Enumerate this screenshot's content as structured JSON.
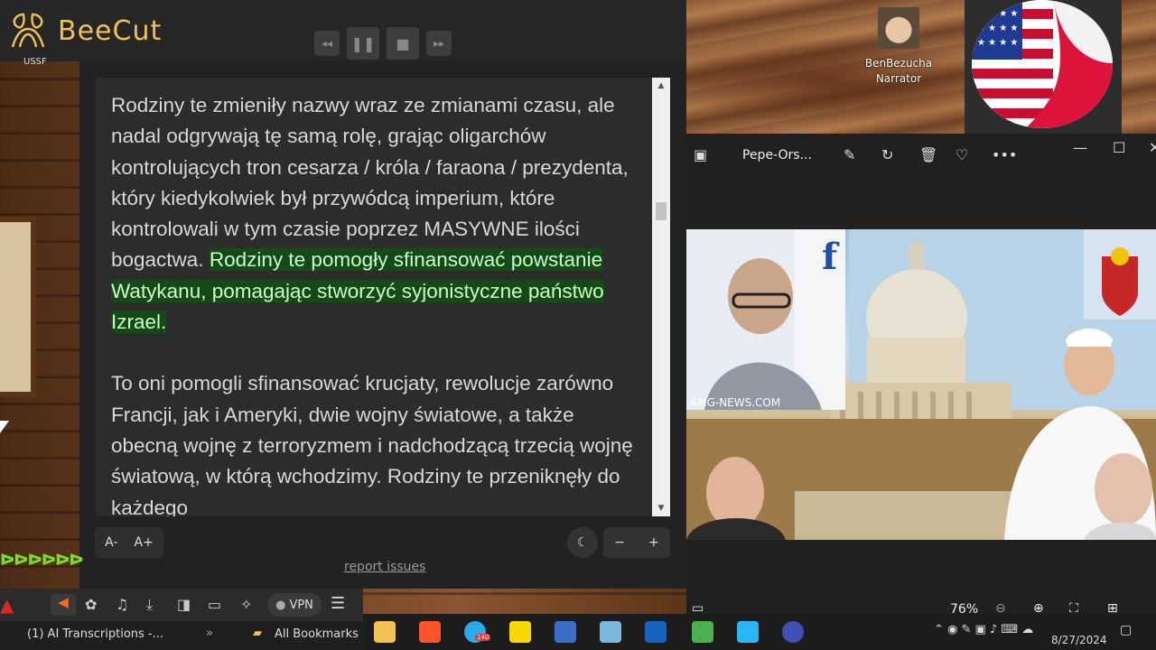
{
  "app": {
    "name": "BeeCut",
    "corner_label": "USSF"
  },
  "reader": {
    "paragraph1_plain": "Rodziny te zmieniły nazwy wraz ze zmianami czasu, ale nadal odgrywają tę samą rolę, grając oligarchów kontrolujących tron cesarza / króla / faraona / prezydenta, który kiedykolwiek był przywódcą imperium, które kontrolowali w tym czasie poprzez MASYWNE ilości bogactwa.",
    "paragraph1_highlight": "Rodziny te pomogły sfinansować powstanie Watykanu, pomagając stworzyć syjonistyczne państwo Izrael.",
    "paragraph2": "To oni pomogli sfinansować krucjaty, rewolucje zarówno Francji, jak i Ameryki, dwie wojny światowe, a także obecną wojnę z terroryzmem i nadchodzącą trzecią wojnę światową, w którą wchodzimy. Rodziny te przeniknęły do każdego",
    "font_decrease": "A-",
    "font_increase": "A+",
    "zoom_minus": "−",
    "zoom_plus": "+",
    "report_link": "report issues",
    "highlight_color": "#134a16"
  },
  "narrator": {
    "name": "BenBezucha",
    "role": "Narrator"
  },
  "viewer": {
    "file_name": "Pepe-Ors...",
    "zoom": "76%",
    "watermark": "AMG-NEWS.COM"
  },
  "browser": {
    "vpn_label": "VPN",
    "tab_label": "(1) AI Transcriptions -...",
    "bookmarks_label": "All Bookmarks"
  },
  "taskbar": {
    "date": "8/27/2024",
    "telegram_badge": "140"
  }
}
